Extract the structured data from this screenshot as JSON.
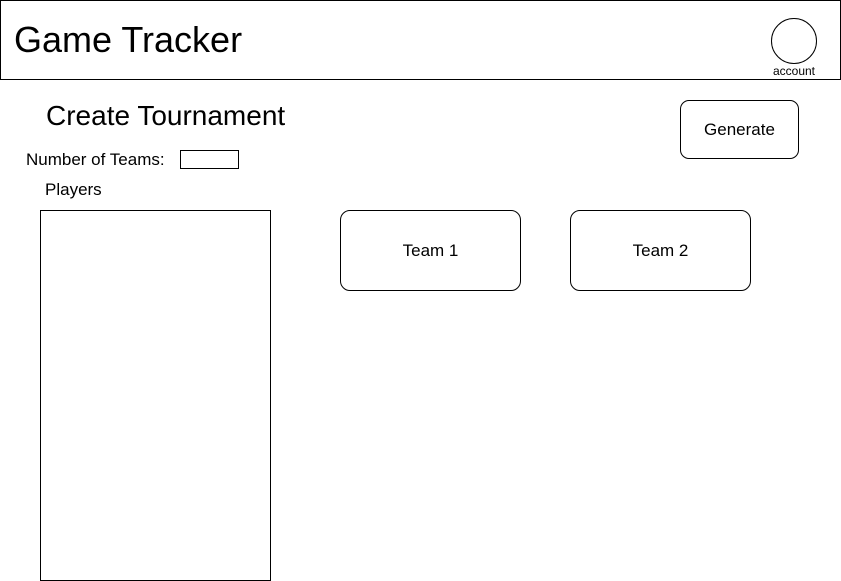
{
  "header": {
    "app_title": "Game Tracker",
    "account_label": "account"
  },
  "main": {
    "page_title": "Create Tournament",
    "generate_label": "Generate",
    "num_teams_label": "Number of Teams:",
    "num_teams_value": "",
    "players_label": "Players",
    "players": [],
    "teams": [
      {
        "label": "Team 1"
      },
      {
        "label": "Team 2"
      }
    ]
  }
}
